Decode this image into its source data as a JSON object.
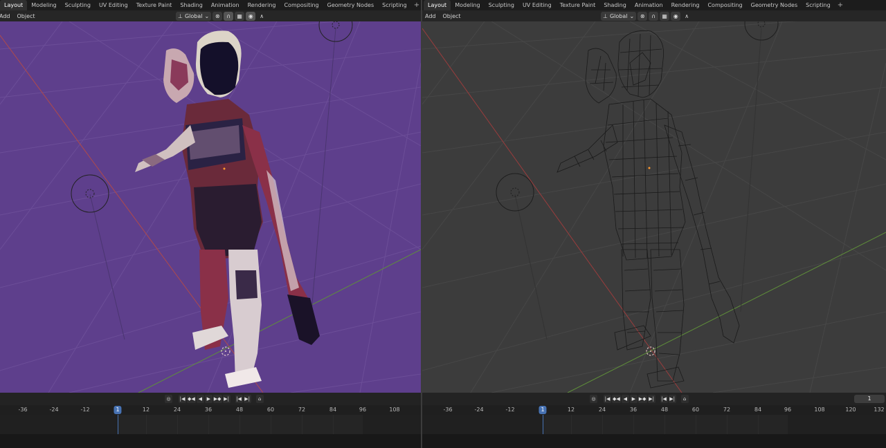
{
  "colors": {
    "accent": "#4772b3",
    "viewport_left_bg": "#5e3f8c",
    "viewport_right_bg": "#3c3c3c",
    "x_axis": "#b04a4a",
    "y_axis": "#5f8f3a"
  },
  "left": {
    "tabs": [
      "Layout",
      "Modeling",
      "Sculpting",
      "UV Editing",
      "Texture Paint",
      "Shading",
      "Animation",
      "Rendering",
      "Compositing",
      "Geometry Nodes",
      "Scripting"
    ],
    "tab_add": "+",
    "menus": [
      "Add",
      "Object"
    ],
    "transform_orientation": "Global",
    "timeline_ticks": [
      "-36",
      "-24",
      "-12",
      "1",
      "12",
      "24",
      "36",
      "48",
      "60",
      "72",
      "84",
      "96",
      "108"
    ],
    "current_frame": "1"
  },
  "right": {
    "tabs": [
      "Layout",
      "Modeling",
      "Sculpting",
      "UV Editing",
      "Texture Paint",
      "Shading",
      "Animation",
      "Rendering",
      "Compositing",
      "Geometry Nodes",
      "Scripting"
    ],
    "tab_add": "+",
    "menus": [
      "Add",
      "Object"
    ],
    "transform_orientation": "Global",
    "timeline_ticks": [
      "-36",
      "-24",
      "-12",
      "1",
      "12",
      "24",
      "36",
      "48",
      "60",
      "72",
      "84",
      "96",
      "108",
      "120",
      "132"
    ],
    "current_frame": "1",
    "frame_field": "1"
  },
  "icons": {
    "orientation": "axis-icon",
    "snapping": "magnet-icon",
    "proportional": "proportional-editing-icon",
    "jump_start": "jump-to-start-icon",
    "play": "play-icon"
  }
}
